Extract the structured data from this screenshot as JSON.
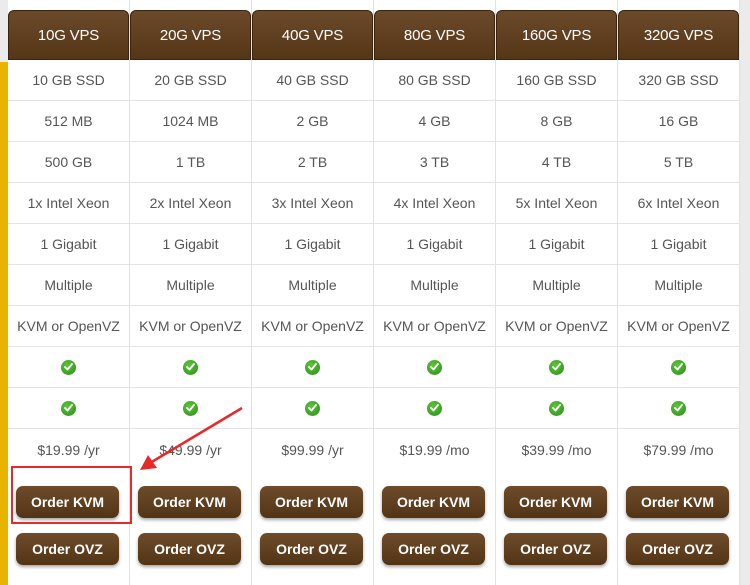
{
  "plans": [
    {
      "name": "10G VPS",
      "features": [
        "10 GB SSD",
        "512 MB",
        "500 GB",
        "1x Intel Xeon",
        "1 Gigabit",
        "Multiple",
        "KVM or OpenVZ"
      ],
      "price": "$19.99 /yr",
      "order_kvm": "Order KVM",
      "order_ovz": "Order OVZ"
    },
    {
      "name": "20G VPS",
      "features": [
        "20 GB SSD",
        "1024 MB",
        "1 TB",
        "2x Intel Xeon",
        "1 Gigabit",
        "Multiple",
        "KVM or OpenVZ"
      ],
      "price": "$49.99 /yr",
      "order_kvm": "Order KVM",
      "order_ovz": "Order OVZ"
    },
    {
      "name": "40G VPS",
      "features": [
        "40 GB SSD",
        "2 GB",
        "2 TB",
        "3x Intel Xeon",
        "1 Gigabit",
        "Multiple",
        "KVM or OpenVZ"
      ],
      "price": "$99.99 /yr",
      "order_kvm": "Order KVM",
      "order_ovz": "Order OVZ"
    },
    {
      "name": "80G VPS",
      "features": [
        "80 GB SSD",
        "4 GB",
        "3 TB",
        "4x Intel Xeon",
        "1 Gigabit",
        "Multiple",
        "KVM or OpenVZ"
      ],
      "price": "$19.99 /mo",
      "order_kvm": "Order KVM",
      "order_ovz": "Order OVZ"
    },
    {
      "name": "160G VPS",
      "features": [
        "160 GB SSD",
        "8 GB",
        "4 TB",
        "5x Intel Xeon",
        "1 Gigabit",
        "Multiple",
        "KVM or OpenVZ"
      ],
      "price": "$39.99 /mo",
      "order_kvm": "Order KVM",
      "order_ovz": "Order OVZ"
    },
    {
      "name": "320G VPS",
      "features": [
        "320 GB SSD",
        "16 GB",
        "5 TB",
        "6x Intel Xeon",
        "1 Gigabit",
        "Multiple",
        "KVM or OpenVZ"
      ],
      "price": "$79.99 /mo",
      "order_kvm": "Order KVM",
      "order_ovz": "Order OVZ"
    }
  ],
  "icons": {
    "check": "check-circle-icon"
  },
  "colors": {
    "header": "#5c3d1e",
    "button": "#5e3f1f",
    "accent": "#e8b400",
    "highlight": "#e52a2a",
    "check": "#3aa020"
  }
}
